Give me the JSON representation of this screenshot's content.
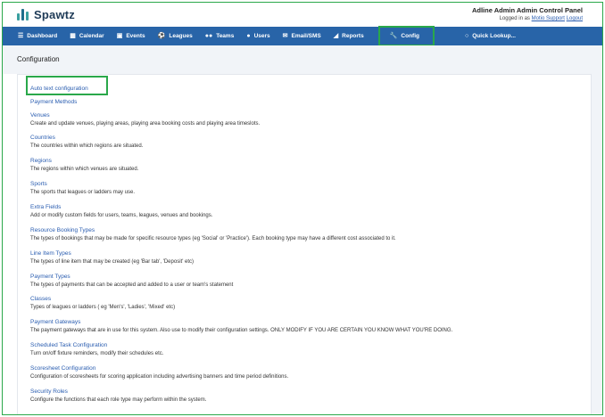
{
  "app": {
    "logo_text": "Spawtz",
    "admin_title": "Adline Admin Admin Control Panel",
    "logged_in_prefix": "Logged in as",
    "logged_in_user": "Motio Support",
    "logout_label": "Logout"
  },
  "nav": {
    "items": [
      {
        "label": "Dashboard",
        "icon": "layers-icon"
      },
      {
        "label": "Calendar",
        "icon": "calendar-icon"
      },
      {
        "label": "Events",
        "icon": "events-icon"
      },
      {
        "label": "Leagues",
        "icon": "ball-icon"
      },
      {
        "label": "Teams",
        "icon": "teams-icon"
      },
      {
        "label": "Users",
        "icon": "user-icon"
      },
      {
        "label": "Email/SMS",
        "icon": "envelope-icon"
      },
      {
        "label": "Reports",
        "icon": "chart-icon"
      },
      {
        "label": "Config",
        "icon": "wrench-icon",
        "active": true
      }
    ],
    "search_label": "Quick Lookup..."
  },
  "page": {
    "title": "Configuration"
  },
  "colors": {
    "nav_bg": "#2864a8",
    "link": "#2a5db0",
    "highlight": "#2aa84a"
  },
  "entries": [
    {
      "label": "Auto text configuration",
      "desc": ""
    },
    {
      "label": "Payment Methods",
      "desc": ""
    },
    {
      "label": "Venues",
      "desc": "Create and update venues, playing areas, playing area booking costs and playing area timeslots."
    },
    {
      "label": "Countries",
      "desc": "The countries within which regions are situated."
    },
    {
      "label": "Regions",
      "desc": "The regions within which venues are situated."
    },
    {
      "label": "Sports",
      "desc": "The sports that leagues or ladders may use."
    },
    {
      "label": "Extra Fields",
      "desc": "Add or modify custom fields for users, teams, leagues, venues and bookings."
    },
    {
      "label": "Resource Booking Types",
      "desc": "The types of bookings that may be made for specific resource types (eg 'Social' or 'Practice'). Each booking type may have a different cost associated to it."
    },
    {
      "label": "Line Item Types",
      "desc": "The types of line item that may be created (eg 'Bar tab', 'Deposit' etc)"
    },
    {
      "label": "Payment Types",
      "desc": "The types of payments that can be accepted and added to a user or team's statement"
    },
    {
      "label": "Classes",
      "desc": "Types of leagues or ladders ( eg 'Men's', 'Ladies', 'Mixed' etc)"
    },
    {
      "label": "Payment Gateways",
      "desc": "The payment gateways that are in use for this system. Also use to modify their configuration settings. ONLY MODIFY IF YOU ARE CERTAIN YOU KNOW WHAT YOU'RE DOING."
    },
    {
      "label": "Scheduled Task Configuration",
      "desc": "Turn on/off fixture reminders, modify their schedules etc."
    },
    {
      "label": "Scoresheet Configuration",
      "desc": "Configuration of scoresheets for scoring application including advertising banners and time period definitions."
    },
    {
      "label": "Security Roles",
      "desc": "Configure the functions that each role type may perform within the system."
    }
  ]
}
